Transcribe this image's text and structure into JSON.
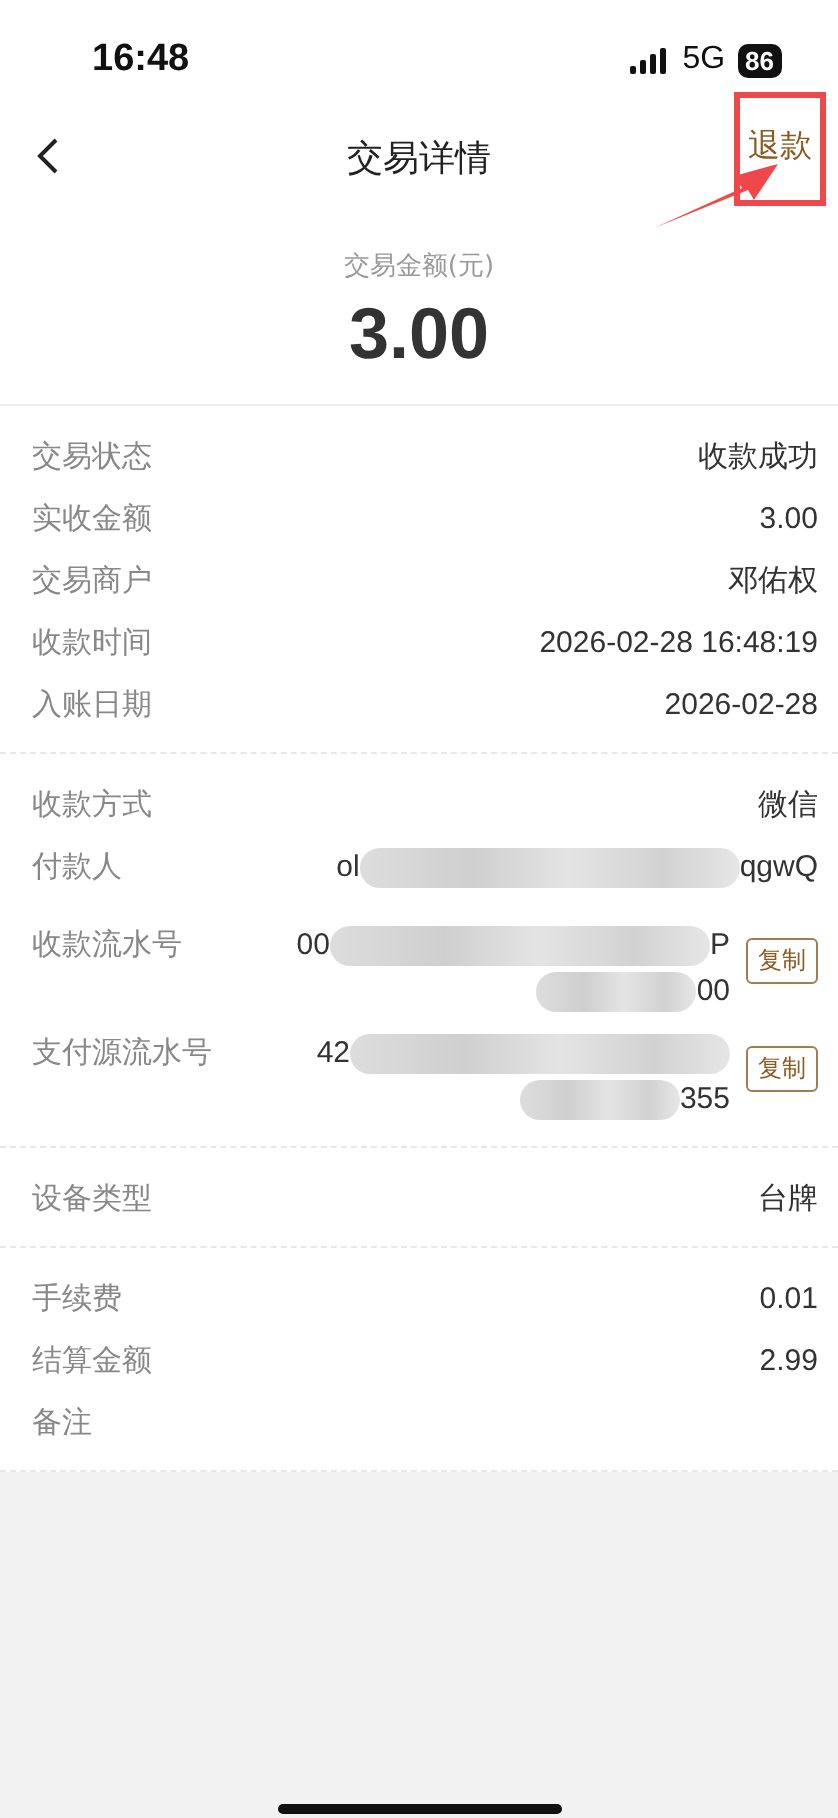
{
  "status_bar": {
    "time": "16:48",
    "network": "5G",
    "battery": "86"
  },
  "nav": {
    "title": "交易详情",
    "action": "退款",
    "highlighted": true
  },
  "amount": {
    "label": "交易金额(元)",
    "value": "3.00"
  },
  "sections": [
    {
      "rows": [
        {
          "kind": "plain",
          "label": "交易状态",
          "value": "收款成功"
        },
        {
          "kind": "plain",
          "label": "实收金额",
          "value": "3.00"
        },
        {
          "kind": "plain",
          "label": "交易商户",
          "value": "邓佑权"
        },
        {
          "kind": "plain",
          "label": "收款时间",
          "value": "2026-02-28 16:48:19"
        },
        {
          "kind": "plain",
          "label": "入账日期",
          "value": "2026-02-28"
        }
      ]
    },
    {
      "rows": [
        {
          "kind": "plain",
          "label": "收款方式",
          "value": "微信"
        },
        {
          "kind": "masked",
          "label": "付款人",
          "lines": [
            {
              "start": "ol",
              "end": "qgwQ"
            }
          ]
        },
        {
          "kind": "masked",
          "label": "收款流水号",
          "lines": [
            {
              "start": "00",
              "end": "P"
            },
            {
              "end": "00"
            }
          ],
          "button": "复制"
        },
        {
          "kind": "masked",
          "label": "支付源流水号",
          "lines": [
            {
              "start": "42"
            },
            {
              "end": "355"
            }
          ],
          "button": "复制"
        }
      ]
    },
    {
      "rows": [
        {
          "kind": "plain",
          "label": "设备类型",
          "value": "台牌"
        }
      ]
    },
    {
      "rows": [
        {
          "kind": "plain",
          "label": "手续费",
          "value": "0.01"
        },
        {
          "kind": "plain",
          "label": "结算金额",
          "value": "2.99"
        },
        {
          "kind": "plain",
          "label": "备注"
        }
      ]
    }
  ]
}
